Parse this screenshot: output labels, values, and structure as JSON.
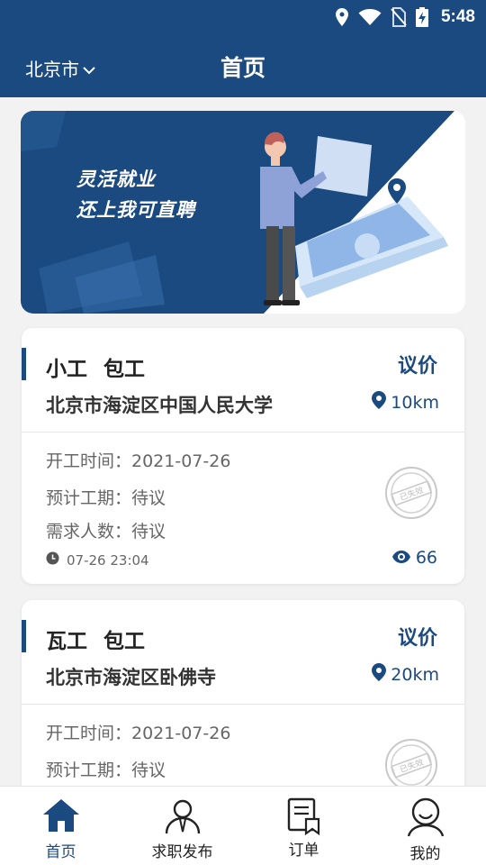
{
  "status_bar": {
    "time": "5:48"
  },
  "header": {
    "city": "北京市",
    "title": "首页"
  },
  "banner": {
    "line1": "灵活就业",
    "line2": "还上我可直聘"
  },
  "jobs": [
    {
      "type": "小工 包工",
      "price": "议价",
      "address": "北京市海淀区中国人民大学",
      "distance": "10km",
      "start_time": "开工时间：2021-07-26",
      "duration": "预计工期：待议",
      "headcount": "需求人数：待议",
      "posted": "07-26 23:04",
      "views": "66",
      "stamp": "已失效"
    },
    {
      "type": "瓦工 包工",
      "price": "议价",
      "address": "北京市海淀区卧佛寺",
      "distance": "20km",
      "start_time": "开工时间：2021-07-26",
      "duration": "预计工期：待议",
      "stamp": "已失效"
    }
  ],
  "nav": [
    {
      "label": "首页",
      "icon": "home-icon",
      "active": true
    },
    {
      "label": "求职发布",
      "icon": "job-seeker-icon"
    },
    {
      "label": "订单",
      "icon": "order-icon"
    },
    {
      "label": "我的",
      "icon": "profile-icon"
    }
  ],
  "colors": {
    "primary": "#1b4a80",
    "background": "#f2f2f2",
    "text": "#222222",
    "muted": "#666666"
  }
}
